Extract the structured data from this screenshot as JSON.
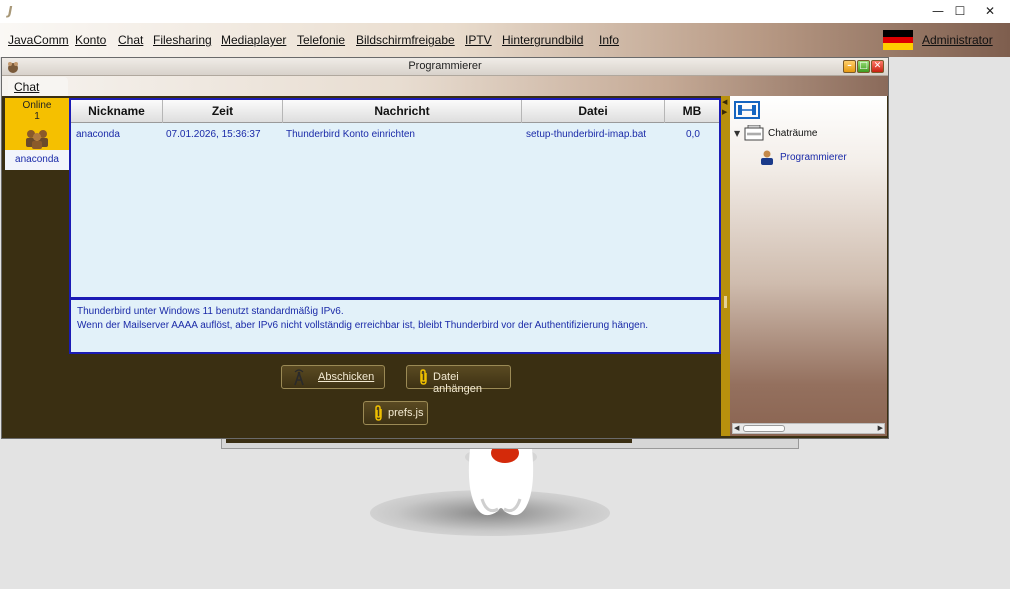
{
  "os": {
    "app_icon": "J",
    "minimize": "—",
    "maximize": "☐",
    "close": "✕"
  },
  "menu": {
    "items": [
      "JavaComm",
      "Konto",
      "Chat",
      "Filesharing",
      "Mediaplayer",
      "Telefonie",
      "Bildschirmfreigabe",
      "IPTV",
      "Hintergrundbild",
      "Info"
    ],
    "user": "Administrator",
    "flag_colors": [
      "#000000",
      "#dd0000",
      "#ffce00"
    ]
  },
  "window": {
    "title": "Programmierer",
    "tab": "Chat"
  },
  "online": {
    "label": "Online",
    "count": "1",
    "user": "anaconda"
  },
  "table": {
    "columns": [
      "Nickname",
      "Zeit",
      "Nachricht",
      "Datei",
      "MB"
    ],
    "rows": [
      {
        "nickname": "anaconda",
        "zeit": "07.01.2026, 15:36:37",
        "nachricht": "Thunderbird Konto einrichten",
        "datei": "setup-thunderbird-imap.bat",
        "mb": "0,0"
      }
    ]
  },
  "message": {
    "line1": "Thunderbird unter Windows 11 benutzt standardmäßig IPv6.",
    "line2": "Wenn der Mailserver AAAA auflöst, aber IPv6 nicht vollständig erreichbar ist, bleibt Thunderbird vor der Authentifizierung hängen."
  },
  "buttons": {
    "send": "Abschicken",
    "attach": "Datei anhängen",
    "file": "prefs.js"
  },
  "rooms": {
    "root_label": "Chaträume",
    "room": "Programmierer"
  },
  "colors": {
    "accent_blue": "#1b1bb5",
    "text_blue": "#1a2aa8",
    "online_yellow": "#f5c000",
    "panel_dark": "#3a2f12"
  }
}
